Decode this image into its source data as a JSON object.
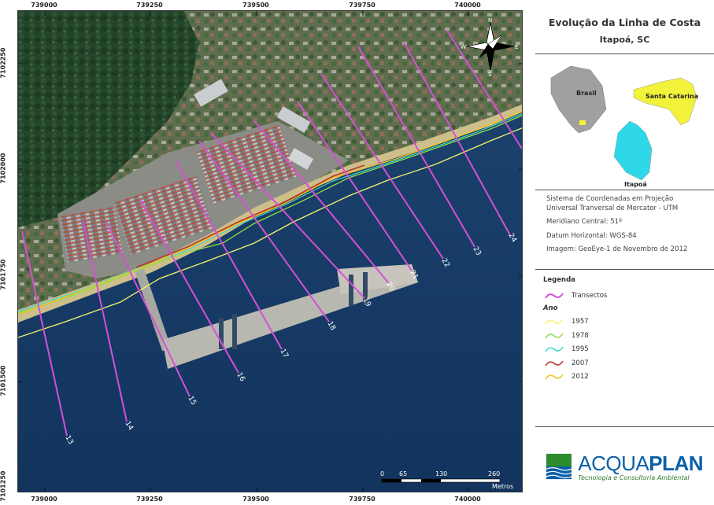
{
  "title": "Evolução da Linha de Costa",
  "subtitle": "Itapoá, SC",
  "grid_x_labels": [
    "739000",
    "739250",
    "739500",
    "739750",
    "740000"
  ],
  "grid_y_labels": [
    "7102250",
    "7102000",
    "7101750",
    "7101500",
    "7101250"
  ],
  "north_arrow": {
    "n": "N",
    "s": "S",
    "e": "E",
    "w": "W"
  },
  "locator": {
    "country": "Brasil",
    "state": "Santa Catarina",
    "municipality": "Itapoá"
  },
  "info": {
    "line1": "Sistema de Coordenadas em Projeção",
    "line2": "Universal Tranversal de Mercator - UTM",
    "meridian": "Meridiano Central: 51º",
    "datum": "Datum Horizontal: WGS-84",
    "image": "Imagem: GeoEye-1 de Novembro de 2012"
  },
  "legend": {
    "title": "Legenda",
    "transect_label": "Transectos",
    "year_title": "Ano",
    "years": [
      {
        "label": "1957",
        "color": "#f5f56a"
      },
      {
        "label": "1978",
        "color": "#8ede4a"
      },
      {
        "label": "1995",
        "color": "#3fd9d0"
      },
      {
        "label": "2007",
        "color": "#b8332a"
      },
      {
        "label": "2012",
        "color": "#f2c21c"
      }
    ],
    "transect_color": "#d64fd6"
  },
  "scale_bar": {
    "labels": [
      "0",
      "65",
      "130",
      "260"
    ],
    "unit": "Metros"
  },
  "transects": [
    "13",
    "14",
    "15",
    "16",
    "17",
    "18",
    "19",
    "20",
    "21",
    "22",
    "23",
    "24"
  ],
  "logo": {
    "name_a": "ACQUA",
    "name_b": "PLAN",
    "tagline": "Tecnologia e Consultoria Ambiental"
  }
}
